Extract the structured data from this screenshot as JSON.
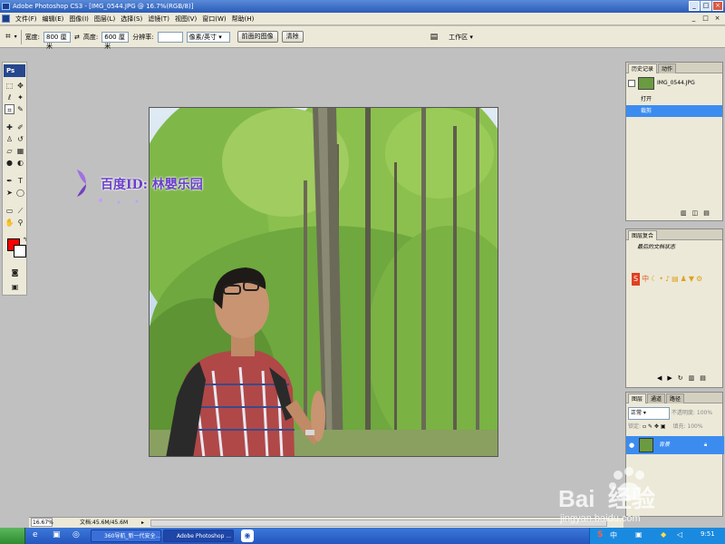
{
  "window": {
    "title": "Adobe Photoshop CS3 - [IMG_0544.JPG @ 16.7%(RGB/8)]",
    "controls": [
      "_",
      "□",
      "×"
    ]
  },
  "menu": {
    "items": [
      "文件(F)",
      "编辑(E)",
      "图像(I)",
      "图层(L)",
      "选择(S)",
      "滤镜(T)",
      "视图(V)",
      "窗口(W)",
      "帮助(H)"
    ],
    "doc_controls": [
      "_",
      "□",
      "×"
    ]
  },
  "options": {
    "width_label": "宽度:",
    "width_value": "800 厘米",
    "height_label": "高度:",
    "height_value": "600 厘米",
    "resolution_label": "分辨率:",
    "resolution_value": "",
    "unit_value": "像素/英寸",
    "front_image_button": "前面的图像",
    "clear_button": "清除",
    "workspace_label": "工作区"
  },
  "toolbox": {
    "logo": "Ps",
    "foreground_color": "#ff0000",
    "background_color": "#ffffff"
  },
  "history_panel": {
    "tabs": [
      "历史记录",
      "动作"
    ],
    "snapshot_name": "IMG_0544.JPG",
    "states": [
      "打开",
      "裁剪"
    ],
    "selected_state": "裁剪"
  },
  "info_panel": {
    "tabs": [
      "图层复合"
    ],
    "last_state": "最后的文档状态"
  },
  "layers_panel": {
    "tabs": [
      "图层",
      "通道",
      "路径"
    ],
    "blend_mode": "正常",
    "opacity_label": "不透明度:",
    "opacity_value": "100%",
    "lock_label": "锁定:",
    "fill_label": "填充:",
    "fill_value": "100%",
    "layer_name": "背景"
  },
  "statusbar": {
    "zoom": "16.67%",
    "doc_info": "文档:45.6M/45.6M"
  },
  "taskbar": {
    "tasks": [
      "360导航_新一代安全...",
      "Adobe Photoshop ..."
    ],
    "clock": "9:51"
  },
  "watermarks": {
    "overlay_text": "百度ID: 林嬰乐园",
    "baidu_logo": "Bai  经验",
    "baidu_url": "jingyan.baidu.com"
  }
}
